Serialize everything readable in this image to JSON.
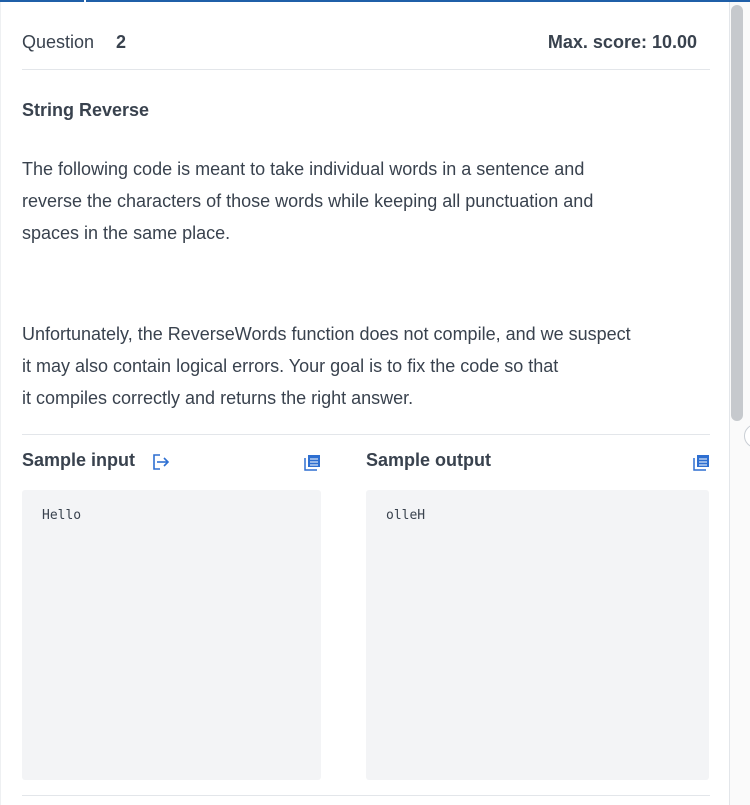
{
  "header": {
    "question_label": "Question",
    "question_number": "2",
    "max_score": "Max. score: 10.00"
  },
  "problem": {
    "title": "String Reverse",
    "paragraph1": [
      "The following code is meant to take individual words in a sentence and",
      "reverse the characters of those words while keeping all punctuation and",
      "spaces in the same place."
    ],
    "paragraph2": [
      "Unfortunately, the ReverseWords function does not compile, and we suspect",
      "it may also contain logical errors. Your goal is to fix the code so that",
      "it compiles correctly and returns the right answer."
    ]
  },
  "samples": {
    "input_title": "Sample input",
    "input_value": "Hello",
    "output_title": "Sample output",
    "output_value": "olleH"
  },
  "icons": {
    "open_input": "export-icon",
    "copy_input": "copy-icon",
    "copy_output": "copy-icon"
  },
  "colors": {
    "accent": "#2e6fd1",
    "text": "#39424e",
    "code_bg": "#f3f4f6",
    "divider": "#e3e6ea"
  }
}
